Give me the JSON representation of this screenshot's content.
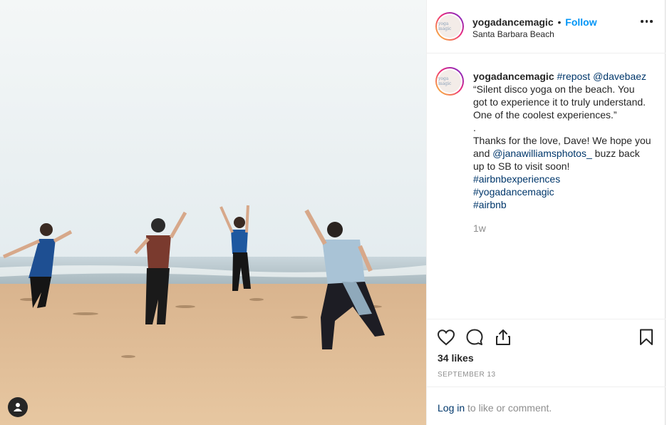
{
  "post": {
    "image_alt": "Dancers on the beach",
    "user_tag_icon": "user-icon"
  },
  "header": {
    "username": "yogadancemagic",
    "separator": "•",
    "follow_label": "Follow",
    "location": "Santa Barbara Beach",
    "avatar_text": "yoga magic",
    "more_icon": "more-horizontal-icon"
  },
  "caption": {
    "username": "yogadancemagic",
    "repost_tag": "#repost",
    "mention_1": "@davebaez",
    "line_1": "“Silent disco yoga on the beach. You",
    "line_2": "got to experience it to truly understand.",
    "line_3": "One of the coolest experiences.”",
    "line_4": ".",
    "line_5": "Thanks for the love, Dave! We hope you",
    "line_6_prefix": "and",
    "mention_2": "@janawilliamsphotos_",
    "line_6_suffix": "buzz back",
    "line_7": "up to SB to visit soon!",
    "hashtag_1": "#airbnbexperiences",
    "hashtag_2": "#yogadancemagic",
    "hashtag_3": "#airbnb",
    "time_ago": "1w"
  },
  "actions": {
    "like_icon": "heart-icon",
    "comment_icon": "comment-icon",
    "share_icon": "share-icon",
    "save_icon": "bookmark-icon",
    "likes": "34 likes",
    "date": "SEPTEMBER 13"
  },
  "comment_bar": {
    "login_label": "Log in",
    "prompt": "to like or comment."
  },
  "colors": {
    "follow": "#0095f6",
    "link": "#00376b",
    "muted": "#8e8e8e",
    "text": "#262626"
  }
}
